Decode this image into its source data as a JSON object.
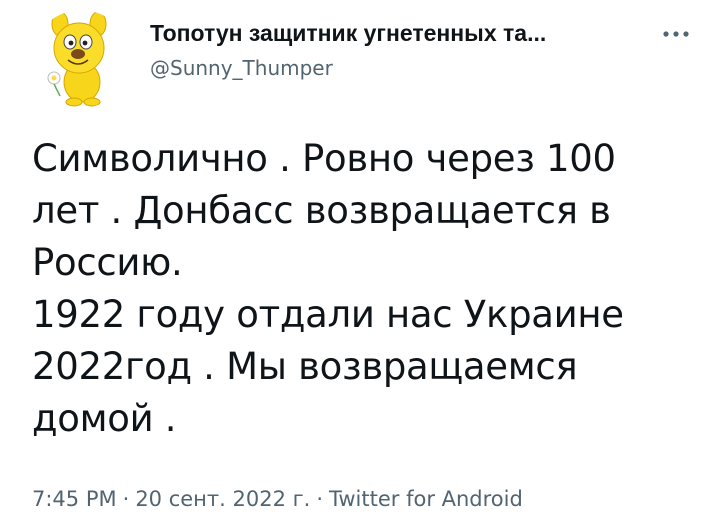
{
  "author": {
    "display_name": "Топотун защитник угнетенных та...",
    "handle": "@Sunny_Thumper",
    "avatar_icon": "cartoon-sun-character-icon"
  },
  "tweet": {
    "lines": [
      "Символично . Ровно через 100",
      "лет . Донбасс возвращается в",
      "Россию.",
      "1922 году отдали нас Украине",
      "2022год . Мы возвращаемся",
      "домой ."
    ],
    "time": "7:45 PM",
    "separator": "·",
    "date": "20 сент. 2022 г.",
    "source": "Twitter for Android"
  },
  "icons": {
    "more": "more-dots-icon"
  },
  "colors": {
    "text_primary": "#0f1419",
    "text_secondary": "#536471",
    "background": "#ffffff"
  }
}
